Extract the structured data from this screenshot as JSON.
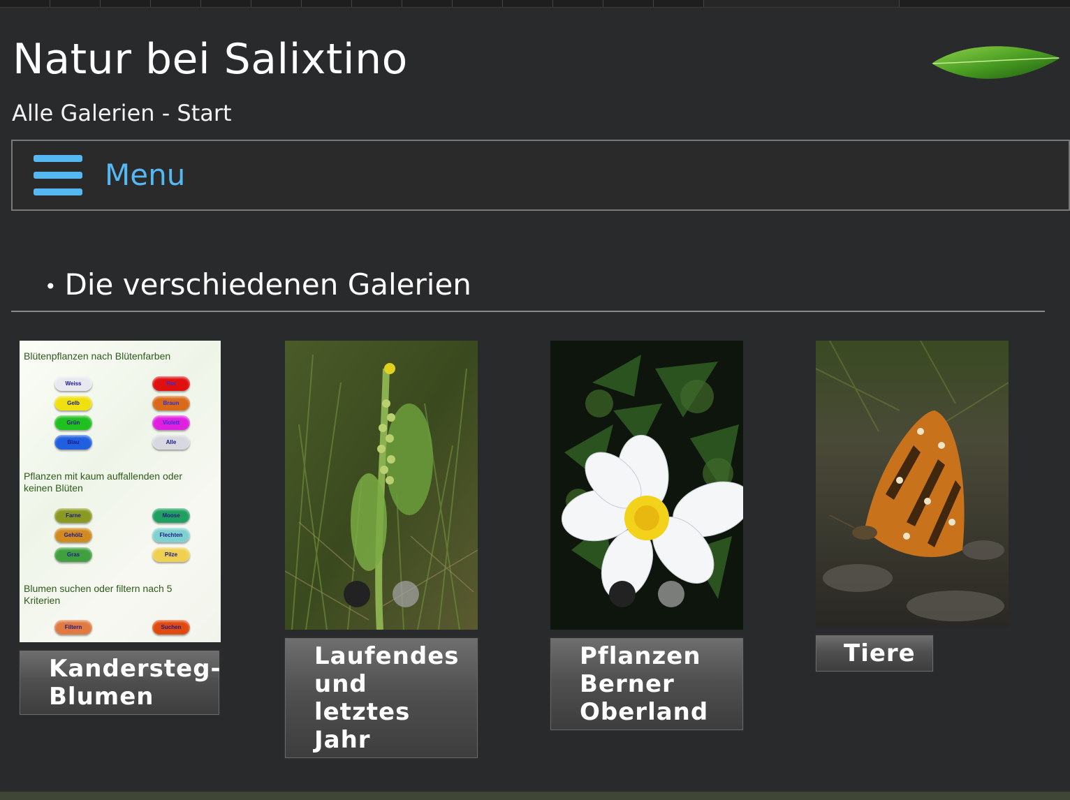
{
  "header": {
    "site_title": "Natur bei Salixtino",
    "subtitle": "Alle Galerien - Start",
    "logo_icon": "leaf-icon"
  },
  "menu": {
    "label": "Menu",
    "icon": "hamburger-icon",
    "accent": "#56b8f0"
  },
  "section": {
    "heading": "Die verschiedenen Galerien"
  },
  "galleries": [
    {
      "caption": "Kandersteg-\nBlumen",
      "thumb": {
        "heading1": "Blütenpflanzen nach Blütenfarben",
        "heading2": "Pflanzen mit kaum auffallenden oder keinen Blüten",
        "heading3": "Blumen suchen oder filtern nach 5 Kriterien",
        "color_buttons": [
          {
            "label": "Weiss",
            "color": "#e8e8f0",
            "text_color": "#1a1a8a"
          },
          {
            "label": "Rot",
            "color": "#e01010",
            "text_color": "#3030d0"
          },
          {
            "label": "Gelb",
            "color": "#f0e010",
            "text_color": "#1a1a8a"
          },
          {
            "label": "Braun",
            "color": "#d96a1a",
            "text_color": "#3030d0"
          },
          {
            "label": "Grün",
            "color": "#20c020",
            "text_color": "#1a1a8a"
          },
          {
            "label": "Violett",
            "color": "#e020e0",
            "text_color": "#3030d0"
          },
          {
            "label": "Blau",
            "color": "#2060e0",
            "text_color": "#1a1a8a"
          },
          {
            "label": "Alle",
            "color": "#d8d8e0",
            "text_color": "#1a1a8a"
          }
        ],
        "other_buttons": [
          {
            "label": "Farne",
            "color": "#8a9a20",
            "text_color": "#1a1a8a"
          },
          {
            "label": "Moose",
            "color": "#20a060",
            "text_color": "#1a1a8a"
          },
          {
            "label": "Gehölz",
            "color": "#d08a20",
            "text_color": "#1a1a8a"
          },
          {
            "label": "Flechten",
            "color": "#80d0d0",
            "text_color": "#1a1a8a"
          },
          {
            "label": "Gras",
            "color": "#40a040",
            "text_color": "#1a1a8a"
          },
          {
            "label": "Pilze",
            "color": "#f0d050",
            "text_color": "#1a1a8a"
          }
        ],
        "action_buttons": [
          {
            "label": "Filtern",
            "color": "#e07a40",
            "text_color": "#1a1a8a"
          },
          {
            "label": "Suchen",
            "color": "#e04a10",
            "text_color": "#1a1a8a"
          }
        ]
      }
    },
    {
      "caption": "Laufendes\nund\nletztes\nJahr",
      "thumb_subject": "green plant in grass"
    },
    {
      "caption": "Pflanzen\nBerner\nOberland",
      "thumb_subject": "white flower with yellow center"
    },
    {
      "caption": "Tiere",
      "thumb_subject": "butterfly on ground"
    }
  ]
}
